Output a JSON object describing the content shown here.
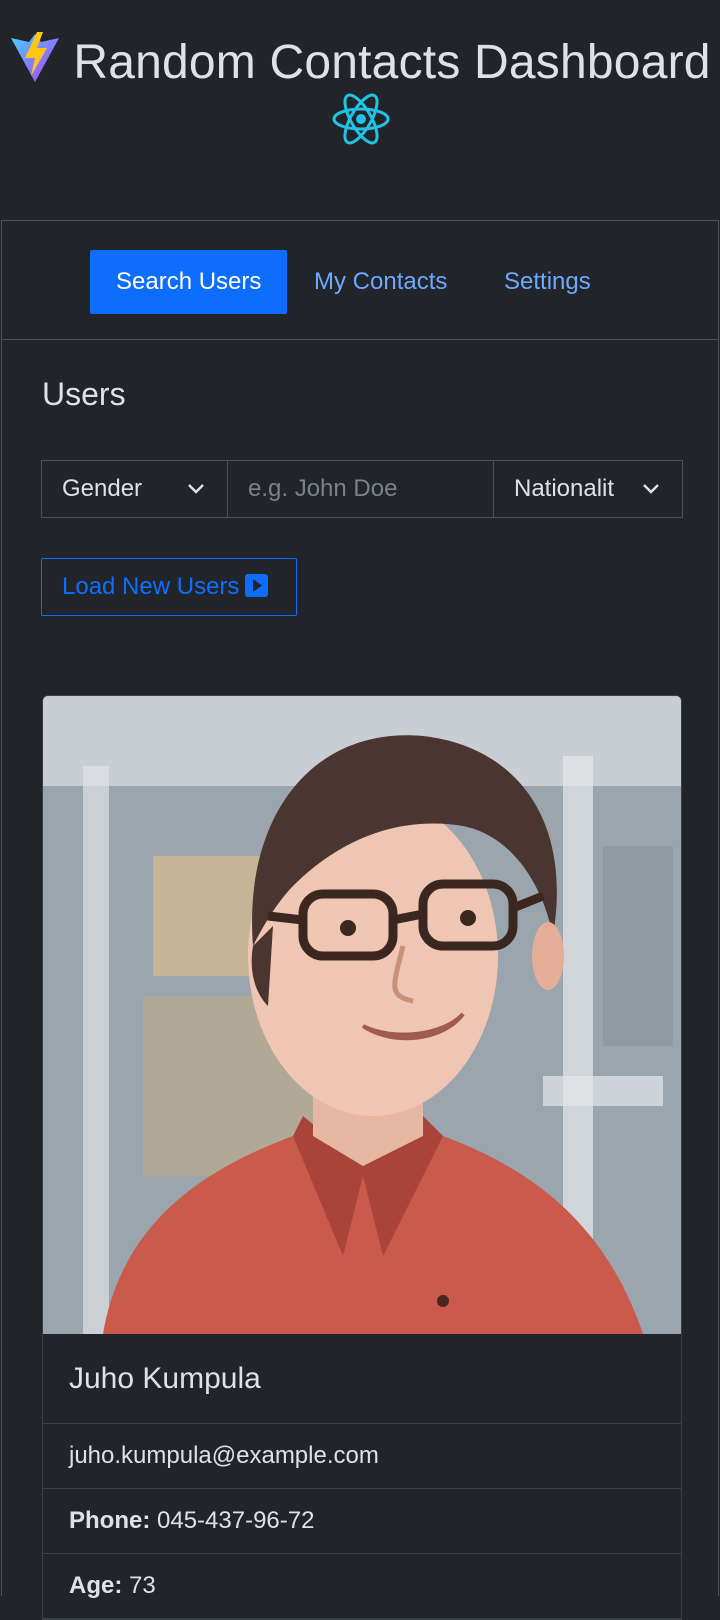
{
  "header": {
    "title": "Random Contacts Dashboard",
    "logo_icon": "vite-logo-icon",
    "secondary_icon": "react-logo-icon",
    "colors": {
      "react": "#22c2e6",
      "vite_purple": "#9d5cf6",
      "vite_yellow": "#ffc517"
    }
  },
  "tabs": [
    {
      "label": "Search Users",
      "active": true
    },
    {
      "label": "My Contacts",
      "active": false
    },
    {
      "label": "Settings",
      "active": false
    }
  ],
  "section": {
    "title": "Users"
  },
  "filters": {
    "gender": {
      "value": "Gender",
      "icon": "chevron-down-icon"
    },
    "name": {
      "value": "",
      "placeholder": "e.g. John Doe"
    },
    "nationality": {
      "value": "Nationalit",
      "icon": "chevron-down-icon"
    }
  },
  "load_button": {
    "label": "Load New Users",
    "icon": "play-square-icon"
  },
  "user_card": {
    "name": "Juho Kumpula",
    "email": "juho.kumpula@example.com",
    "phone_label": "Phone:",
    "phone": "045-437-96-72",
    "age_label": "Age:",
    "age": "73"
  },
  "colors": {
    "primary": "#0d6efd",
    "link": "#6ea8fe",
    "background": "#212529",
    "border": "#495057"
  }
}
